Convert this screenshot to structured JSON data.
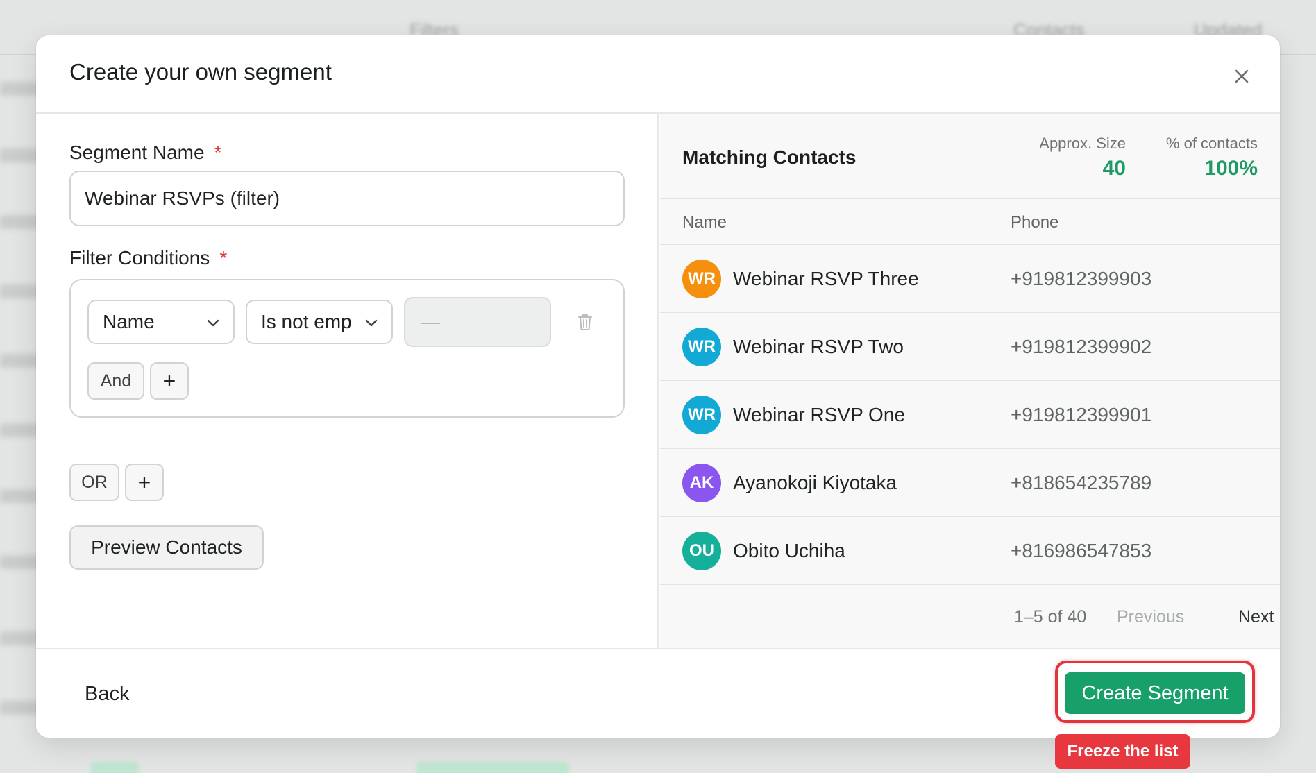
{
  "background": {
    "header_cols": [
      "Filters",
      "Contacts",
      "Updated"
    ]
  },
  "modal": {
    "title": "Create your own segment",
    "close_icon": "close-icon"
  },
  "form": {
    "segment_name_label": "Segment Name",
    "required_mark": "*",
    "segment_name_value": "Webinar RSVPs (filter)",
    "filter_conditions_label": "Filter Conditions",
    "condition": {
      "field": "Name",
      "operator": "Is not emp",
      "value_placeholder": "—"
    },
    "and_label": "And",
    "or_label": "OR",
    "plus_label": "+",
    "preview_button": "Preview Contacts"
  },
  "matching": {
    "title": "Matching Contacts",
    "approx_size_label": "Approx. Size",
    "approx_size_value": "40",
    "percent_label": "% of contacts",
    "percent_value": "100%",
    "columns": [
      "Name",
      "Phone"
    ],
    "rows": [
      {
        "initials": "WR",
        "name": "Webinar RSVP Three",
        "phone": "+919812399903",
        "color": "#f5900f"
      },
      {
        "initials": "WR",
        "name": "Webinar RSVP Two",
        "phone": "+919812399902",
        "color": "#12a9d4"
      },
      {
        "initials": "WR",
        "name": "Webinar RSVP One",
        "phone": "+919812399901",
        "color": "#12a9d4"
      },
      {
        "initials": "AK",
        "name": "Ayanokoji Kiyotaka",
        "phone": "+818654235789",
        "color": "#8b55f0"
      },
      {
        "initials": "OU",
        "name": "Obito Uchiha",
        "phone": "+816986547853",
        "color": "#14b09a"
      }
    ],
    "pager": {
      "range": "1–5 of 40",
      "previous": "Previous",
      "next": "Next"
    }
  },
  "footer": {
    "back": "Back",
    "create": "Create Segment",
    "tooltip": "Freeze the list"
  },
  "colors": {
    "accent_green": "#17a06a",
    "highlight_red": "#e0353c"
  }
}
